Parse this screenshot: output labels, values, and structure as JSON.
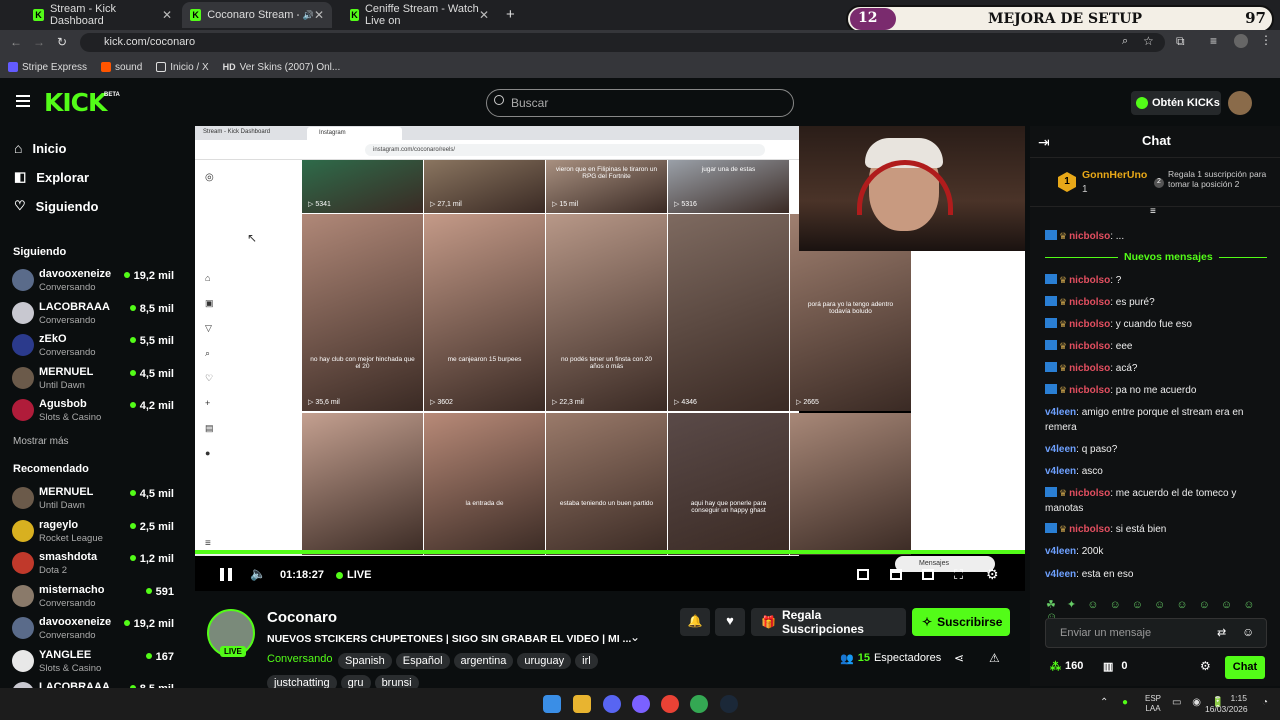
{
  "browser": {
    "tabs": [
      {
        "title": "Stream - Kick Dashboard"
      },
      {
        "title": "Coconaro Stream - Watch L"
      },
      {
        "title": "Ceniffe Stream - Watch Live on"
      }
    ],
    "url": "kick.com/coconaro",
    "bookmarks": [
      "Stripe Express",
      "sound",
      "Inicio / X",
      "Ver Skins (2007) Onl..."
    ]
  },
  "promo": {
    "left_number": "12",
    "title": "MEJORA DE SETUP",
    "right_number": "97"
  },
  "header": {
    "logo": "KICK",
    "beta": "BETA",
    "search_placeholder": "Buscar",
    "kicks_button": "Obtén KICKs"
  },
  "nav": [
    {
      "label": "Inicio",
      "icon": "home-icon"
    },
    {
      "label": "Explorar",
      "icon": "compass-icon"
    },
    {
      "label": "Siguiendo",
      "icon": "heart-icon"
    }
  ],
  "sidebar": {
    "following_title": "Siguiendo",
    "following": [
      {
        "name": "davooxeneize",
        "category": "Conversando",
        "viewers": "19,2 mil",
        "color": "#5a6b8a"
      },
      {
        "name": "LACOBRAAA",
        "category": "Conversando",
        "viewers": "8,5 mil",
        "color": "#c8c8d0"
      },
      {
        "name": "zEkO",
        "category": "Conversando",
        "viewers": "5,5 mil",
        "color": "#2b3a8c"
      },
      {
        "name": "MERNUEL",
        "category": "Until Dawn",
        "viewers": "4,5 mil",
        "color": "#6b5a4a"
      },
      {
        "name": "Agusbob",
        "category": "Slots & Casino",
        "viewers": "4,2 mil",
        "color": "#b01c3a"
      }
    ],
    "show_more": "Mostrar más",
    "recommended_title": "Recomendado",
    "recommended": [
      {
        "name": "MERNUEL",
        "category": "Until Dawn",
        "viewers": "4,5 mil",
        "color": "#6b5a4a"
      },
      {
        "name": "rageylo",
        "category": "Rocket League",
        "viewers": "2,5 mil",
        "color": "#d8b020"
      },
      {
        "name": "smashdota",
        "category": "Dota 2",
        "viewers": "1,2 mil",
        "color": "#c0392b"
      },
      {
        "name": "misternacho",
        "category": "Conversando",
        "viewers": "591",
        "color": "#8a7a6a"
      },
      {
        "name": "davooxeneize",
        "category": "Conversando",
        "viewers": "19,2 mil",
        "color": "#5a6b8a"
      },
      {
        "name": "YANGLEE",
        "category": "Slots & Casino",
        "viewers": "167",
        "color": "#e8e8e8"
      },
      {
        "name": "LACOBRAAA",
        "category": "",
        "viewers": "8,5 mil",
        "color": "#c8c8d0"
      }
    ]
  },
  "player": {
    "ig_url": "instagram.com/coconaro/reels/",
    "ig_tab1": "Stream - Kick Dashboard",
    "ig_tab2": "Instagram",
    "tiles": [
      {
        "views": "5341",
        "caption": ""
      },
      {
        "views": "27,1 mil",
        "caption": ""
      },
      {
        "views": "15 mil",
        "caption": "vieron que en Filipinas le tiraron un RPG del Fortnite"
      },
      {
        "views": "5316",
        "caption": "jugar una de estas"
      },
      {
        "views": "35,6 mil",
        "caption": "no hay club con mejor hinchada que el 20"
      },
      {
        "views": "3602",
        "caption": "me canjearon 15 burpees"
      },
      {
        "views": "22,3 mil",
        "caption": "no podés tener un finsta con 20 años o más"
      },
      {
        "views": "4346",
        "caption": ""
      },
      {
        "views": "2665",
        "caption": "porá para yo la tengo adentro todavía boludo"
      },
      {
        "views": "",
        "caption": ""
      },
      {
        "views": "",
        "caption": "la entrada de"
      },
      {
        "views": "",
        "caption": "estaba teniendo un buen partido"
      },
      {
        "views": "",
        "caption": "aqui hay que ponerle para conseguir un happy ghast"
      },
      {
        "views": "",
        "caption": ""
      }
    ],
    "mini_chat_label": "Mensajes",
    "timer": "01:18:27",
    "live_label": "LIVE",
    "progress": 1.0
  },
  "stream": {
    "channel": "Coconaro",
    "live_badge": "LIVE",
    "title": "NUEVOS STCIKERS CHUPETONES | SIGO SIN GRABAR EL VIDEO | MI ...",
    "category": "Conversando",
    "tags": [
      "Spanish",
      "Español",
      "argentina",
      "uruguay",
      "irl",
      "justchatting",
      "gru",
      "brunsi"
    ],
    "gift_button": "Regala Suscripciones",
    "subscribe_button": "Suscribirse",
    "viewer_count": "15",
    "viewer_label": "Espectadores"
  },
  "chat": {
    "title": "Chat",
    "leader": {
      "name": "GonnHerUno",
      "count": "1",
      "rank": "2",
      "text": "Regala 1 suscripción para tomar la posición 2"
    },
    "new_messages": "Nuevos mensajes",
    "messages": [
      {
        "user": "nicbolso",
        "text": "...",
        "style": "red",
        "badges": true
      },
      {
        "user": "nicbolso",
        "text": "?",
        "style": "red",
        "badges": true
      },
      {
        "user": "nicbolso",
        "text": "es puré?",
        "style": "red",
        "badges": true
      },
      {
        "user": "nicbolso",
        "text": "y cuando fue eso",
        "style": "red",
        "badges": true
      },
      {
        "user": "nicbolso",
        "text": "eee",
        "style": "red",
        "badges": true
      },
      {
        "user": "nicbolso",
        "text": "acá?",
        "style": "red",
        "badges": true
      },
      {
        "user": "nicbolso",
        "text": "pa no me acuerdo",
        "style": "red",
        "badges": true
      },
      {
        "user": "v4leen",
        "text": "amigo entre porque el stream era en remera",
        "style": "blue",
        "badges": false
      },
      {
        "user": "v4leen",
        "text": "q paso?",
        "style": "blue",
        "badges": false
      },
      {
        "user": "v4leen",
        "text": "asco",
        "style": "blue",
        "badges": false
      },
      {
        "user": "nicbolso",
        "text": "me acuerdo el de tomeco y manotas",
        "style": "red",
        "badges": true
      },
      {
        "user": "nicbolso",
        "text": "si está bien",
        "style": "red",
        "badges": true
      },
      {
        "user": "v4leen",
        "text": "200k",
        "style": "blue",
        "badges": false
      },
      {
        "user": "v4leen",
        "text": "esta en eso",
        "style": "blue",
        "badges": false
      }
    ],
    "input_placeholder": "Enviar un mensaje",
    "points": "160",
    "gifts": "0",
    "send_button": "Chat"
  },
  "taskbar": {
    "lang": "ESP",
    "lang2": "LAA",
    "time": "1:15",
    "date": "16/03/2026"
  },
  "colors": {
    "accent": "#53fc18",
    "bg": "#0b0e0f"
  }
}
